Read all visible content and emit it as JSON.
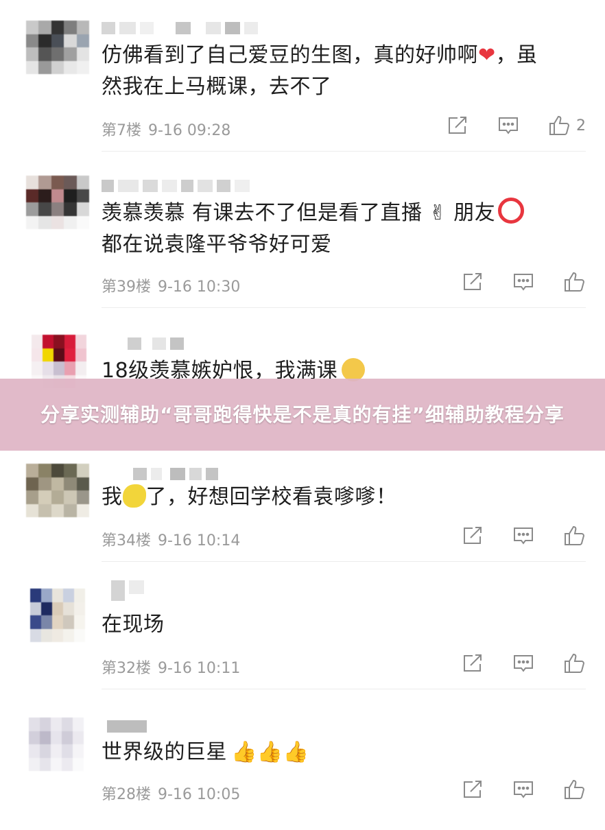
{
  "comments": [
    {
      "text_line1": "仿佛看到了自己爱豆的生图，真的好帅啊",
      "text_line1_end": "，虽",
      "text_line2": "然我在上马概课，去不了",
      "floor": "第7楼",
      "time": "9-16 09:28",
      "likes": "2",
      "emoji": "heart-emoji"
    },
    {
      "text_line1": "羡慕羡慕 有课去不了但是看了直播",
      "text_line1_end": " 朋友",
      "text_line2": "都在说袁隆平爷爷好可爱",
      "floor": "第39楼",
      "time": "9-16 10:30",
      "likes": "",
      "emoji": "finger-heart-emoji"
    },
    {
      "text_line1": "18级羡慕嫉妒恨，我满课",
      "floor": "",
      "time": "",
      "likes": "",
      "emoji": "crying-emoji"
    },
    {
      "text_line1": "我",
      "text_line1_end": "了，好想回学校看袁嗲嗲！",
      "floor": "第34楼",
      "time": "9-16 10:14",
      "likes": "",
      "emoji": "lemon-emoji"
    },
    {
      "text_line1": "在现场",
      "floor": "第32楼",
      "time": "9-16 10:11",
      "likes": ""
    },
    {
      "text_line1": "世界级的巨星",
      "floor": "第28楼",
      "time": "9-16 10:05",
      "likes": "",
      "emoji": "thumbs-up-emoji"
    }
  ],
  "banner": {
    "text": "分享实测辅助“哥哥跑得快是不是真的有挂”细辅助教程分享"
  },
  "icons": {
    "share": "share-icon",
    "comment": "comment-icon",
    "like": "thumbs-up-icon"
  },
  "colors": {
    "banner_bg": "#deb4c4",
    "meta_text": "#9a9a9a",
    "heart": "#e8363f",
    "circle": "#e8363f"
  }
}
